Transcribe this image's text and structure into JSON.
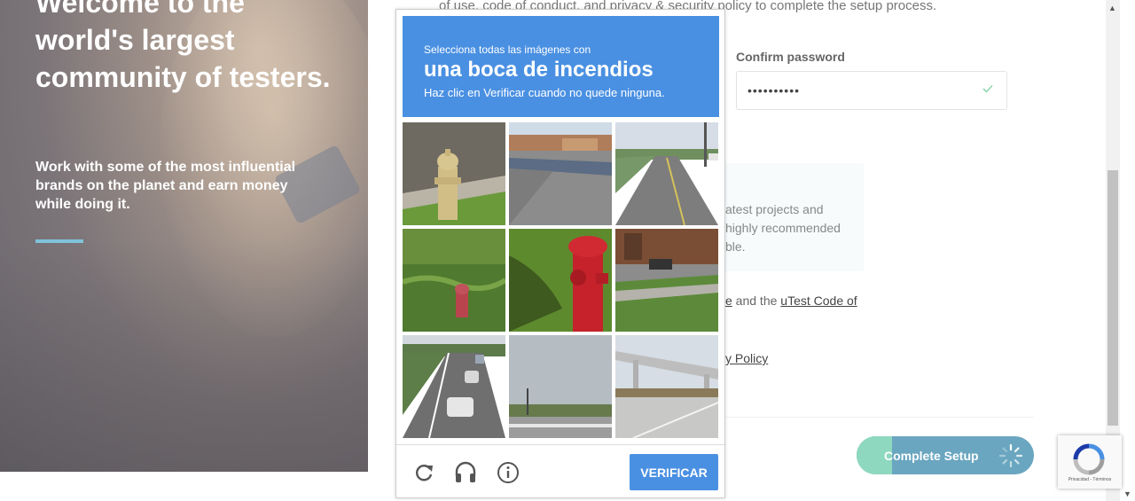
{
  "hero": {
    "title": "Welcome to the world's largest community of testers.",
    "subtitle": "Work with some of the most influential brands on the planet and earn money while doing it."
  },
  "form": {
    "terms_text": "of use, code of conduct, and privacy & security policy to complete the setup process.",
    "confirm_password_label": "Confirm password",
    "confirm_password_value": "••••••••••",
    "info_text": "atest projects and highly recommended ble.",
    "agree_text_visible": "e",
    "agree_mid": " and the ",
    "code_link": "uTest Code of",
    "policy_link": "y Policy",
    "complete_button": "Complete Setup"
  },
  "captcha": {
    "header_small": "Selecciona todas las imágenes con",
    "header_object": "una boca de incendios",
    "header_instruction": "Haz clic en Verificar cuando no quede ninguna.",
    "verify_button": "VERIFICAR",
    "tiles": [
      {
        "subject": "yellow fire hydrant by road"
      },
      {
        "subject": "parking lot with buildings"
      },
      {
        "subject": "road with utility poles"
      },
      {
        "subject": "red hydrant in tall grass"
      },
      {
        "subject": "red fire hydrant closeup"
      },
      {
        "subject": "sidewalk with parked car"
      },
      {
        "subject": "highway traffic"
      },
      {
        "subject": "fence and sky"
      },
      {
        "subject": "highway overpass"
      }
    ]
  },
  "recaptcha_badge": {
    "links": "Privacidad - Términos"
  },
  "colors": {
    "captcha_blue": "#4a90e2",
    "button_teal": "#8fd8c0",
    "button_blue": "#6aa6c0",
    "hero_accent": "#7fc3db"
  }
}
